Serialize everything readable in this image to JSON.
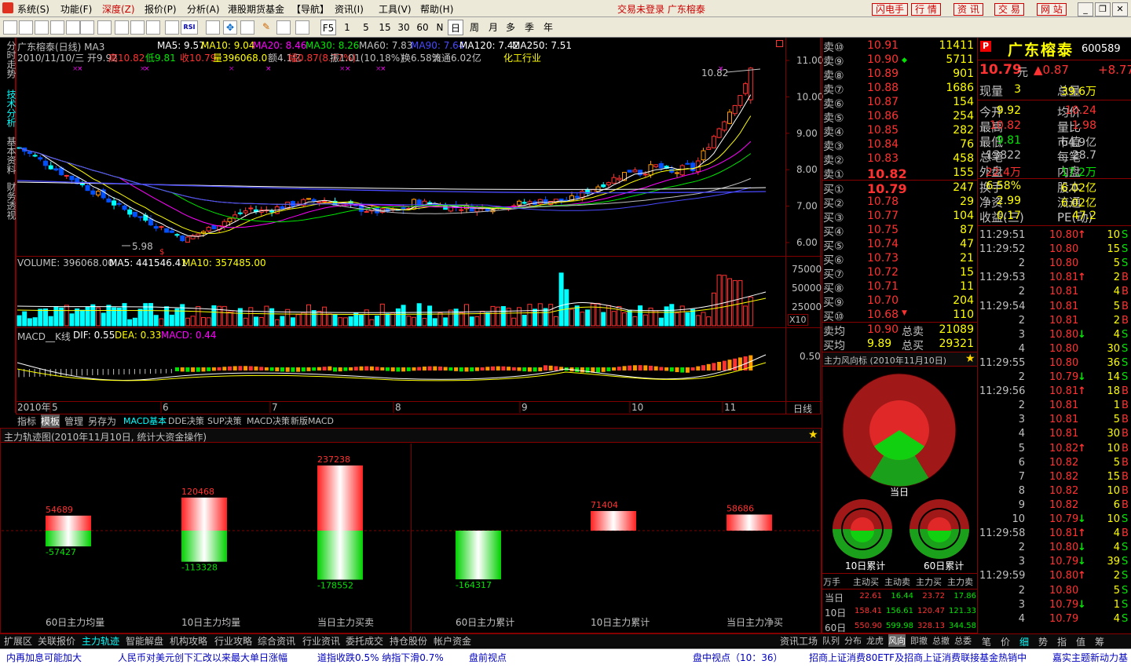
{
  "menu": {
    "items": [
      "系统(S)",
      "功能(F)",
      "深度(Z)",
      "报价(P)",
      "分析(A)",
      "港股期货基金",
      "【导航】",
      "资讯(I)",
      "工具(V)",
      "帮助(H)"
    ],
    "status": "交易未登录  广东榕泰",
    "right_buttons": [
      "闪电手",
      "行 情",
      "资 讯",
      "交 易",
      "网 站"
    ]
  },
  "toolbar": {
    "periods": [
      "F5",
      "1",
      "5",
      "15",
      "30",
      "60",
      "N",
      "日",
      "周",
      "月",
      "多",
      "季",
      "年"
    ]
  },
  "left_tabs": [
    "分时走势",
    "技术分析",
    "基本资料",
    "财务透视"
  ],
  "chart": {
    "title": "广东榕泰(日线) MA3",
    "ma_labels": [
      {
        "t": "MA5: 9.57",
        "c": "#ffffff"
      },
      {
        "t": "MA10: 9.04",
        "c": "#ffff00"
      },
      {
        "t": "MA20: 8.46",
        "c": "#ff00ff"
      },
      {
        "t": "MA30: 8.26",
        "c": "#00e600"
      },
      {
        "t": "MA60: 7.83",
        "c": "#c0c0c0"
      },
      {
        "t": "MA90: 7.64",
        "c": "#4a4aff"
      },
      {
        "t": "MA120: 7.42",
        "c": "#ffffff"
      },
      {
        "t": "MA250: 7.51",
        "c": "#ffffff"
      }
    ],
    "info_line": [
      {
        "t": "2010/11/10/三 开9.92",
        "c": "#c0c0c0"
      },
      {
        "t": "高10.82",
        "c": "#ff3232"
      },
      {
        "t": "低9.81",
        "c": "#00e600"
      },
      {
        "t": "收10.79",
        "c": "#ff3232"
      },
      {
        "t": "量396068.0",
        "c": "#ffff00"
      },
      {
        "t": "额4.1亿",
        "c": "#c0c0c0"
      },
      {
        "t": "幅0.87(8.77%)",
        "c": "#ff3232"
      },
      {
        "t": "振1.01(10.18%)",
        "c": "#c0c0c0"
      },
      {
        "t": "换6.58%",
        "c": "#c0c0c0"
      },
      {
        "t": "流通6.02亿",
        "c": "#c0c0c0"
      },
      {
        "t": "化工行业",
        "c": "#ffff00"
      }
    ],
    "price_axis": [
      "11.00",
      "10.00",
      "9.00",
      "8.00",
      "7.00",
      "6.00"
    ],
    "high_mark": "10.82",
    "low_mark": "5.98",
    "volume_title": "VOLUME: 396068.00",
    "volume_ma5": "MA5: 441546.41",
    "volume_ma10": "MA10: 357485.00",
    "volume_axis": [
      "75000",
      "50000",
      "25000"
    ],
    "volume_unit": "X10",
    "macd_title": "MACD__K线",
    "macd_dif": "DIF: 0.55",
    "macd_dea": "DEA: 0.33",
    "macd_val": "MACD: 0.44",
    "macd_axis": "0.50",
    "date_labels": [
      "2010年",
      "5",
      "6",
      "7",
      "8",
      "9",
      "10",
      "11"
    ],
    "period_label": "日线"
  },
  "indicator_tabs": [
    "指标",
    "模板",
    "管理",
    "另存为",
    "MACD基本",
    "DDE决策",
    "SUP决策",
    "MACD决策",
    "新版MACD"
  ],
  "main_force": {
    "title": "主力轨迹图(2010年11月10日, 统计大资金操作)",
    "groups": [
      {
        "label": "60日主力均量",
        "pos": "54689",
        "neg": "-57427"
      },
      {
        "label": "10日主力均量",
        "pos": "120468",
        "neg": "-113328"
      },
      {
        "label": "当日主力买卖",
        "pos": "237238",
        "neg": "-178552"
      },
      {
        "label": "60日主力累计",
        "pos": "",
        "neg": "-164317"
      },
      {
        "label": "10日主力累计",
        "pos": "71404",
        "neg": ""
      },
      {
        "label": "当日主力净买",
        "pos": "58686",
        "neg": ""
      }
    ]
  },
  "bottom_tabs": [
    "扩展区",
    "关联报价",
    "主力轨迹",
    "智能解盘",
    "机构攻略",
    "行业攻略",
    "综合资讯",
    "行业资讯",
    "委托成交",
    "持仓股份",
    "帐户资金"
  ],
  "bottom_right": "资讯工场",
  "ticker": [
    "内再加息可能加大",
    "人民币对美元创下汇改以来最大单日涨幅",
    "道指收跌0.5% 纳指下滑0.7%",
    "盘前视点",
    "盘中视点（10：36）",
    "招商上证消费80ETF及招商上证消费联接基金热销中",
    "嘉实主题新动力基"
  ],
  "order_book": {
    "asks": [
      {
        "l": "卖⑩",
        "p": "10.91",
        "v": "11411"
      },
      {
        "l": "卖⑨",
        "p": "10.90",
        "v": "5711"
      },
      {
        "l": "卖⑧",
        "p": "10.89",
        "v": "901"
      },
      {
        "l": "卖⑦",
        "p": "10.88",
        "v": "1686"
      },
      {
        "l": "卖⑥",
        "p": "10.87",
        "v": "154"
      },
      {
        "l": "卖⑤",
        "p": "10.86",
        "v": "254"
      },
      {
        "l": "卖④",
        "p": "10.85",
        "v": "282"
      },
      {
        "l": "卖③",
        "p": "10.84",
        "v": "76"
      },
      {
        "l": "卖②",
        "p": "10.83",
        "v": "458"
      },
      {
        "l": "卖①",
        "p": "10.82",
        "v": "155"
      }
    ],
    "bids": [
      {
        "l": "买①",
        "p": "10.79",
        "v": "247"
      },
      {
        "l": "买②",
        "p": "10.78",
        "v": "29"
      },
      {
        "l": "买③",
        "p": "10.77",
        "v": "104"
      },
      {
        "l": "买④",
        "p": "10.75",
        "v": "87"
      },
      {
        "l": "买⑤",
        "p": "10.74",
        "v": "47"
      },
      {
        "l": "买⑥",
        "p": "10.73",
        "v": "21"
      },
      {
        "l": "买⑦",
        "p": "10.72",
        "v": "15"
      },
      {
        "l": "买⑧",
        "p": "10.71",
        "v": "11"
      },
      {
        "l": "买⑨",
        "p": "10.70",
        "v": "204"
      },
      {
        "l": "买⑩",
        "p": "10.68",
        "v": "110"
      }
    ],
    "avg_sell": {
      "l": "卖均",
      "p": "10.90",
      "tl": "总卖",
      "tv": "21089"
    },
    "avg_buy": {
      "l": "买均",
      "p": "9.89",
      "tl": "总买",
      "tv": "29321"
    }
  },
  "flow": {
    "title": "主力风向标 (2010年11月10日)",
    "today": "当日",
    "d10": "10日累计",
    "d60": "60日累计",
    "headers": [
      "万手",
      "主动买",
      "主动卖",
      "主力买",
      "主力卖"
    ],
    "rows": [
      {
        "l": "当日",
        "v": [
          "22.61",
          "16.44",
          "23.72",
          "17.86"
        ]
      },
      {
        "l": "10日",
        "v": [
          "158.41",
          "156.61",
          "120.47",
          "121.33"
        ]
      },
      {
        "l": "60日",
        "v": [
          "550.90",
          "599.98",
          "328.13",
          "344.58"
        ]
      }
    ],
    "tabs": [
      "队列",
      "分布",
      "龙虎",
      "风向",
      "即撤",
      "总撤",
      "总委"
    ]
  },
  "quote": {
    "name": "广东榕泰",
    "code": "600589",
    "price": "10.79",
    "unit": "元",
    "change": "▲0.87",
    "change2": "+8.77",
    "rows": [
      [
        {
          "l": "现量",
          "v": "3"
        },
        {
          "l": "总量",
          "v": "39.6万"
        }
      ],
      [
        {
          "l": "今开",
          "v": "9.92"
        },
        {
          "l": "均价",
          "v": "10.24"
        }
      ],
      [
        {
          "l": "最高",
          "v": "10.82"
        },
        {
          "l": "量比",
          "v": "1.98"
        }
      ],
      [
        {
          "l": "最低",
          "v": "9.81"
        },
        {
          "l": "市值",
          "v": "64.9亿"
        }
      ],
      [
        {
          "l": "总笔",
          "v": "13822"
        },
        {
          "l": "每笔",
          "v": "28.7"
        }
      ],
      [
        {
          "l": "外盘",
          "v": "22.4万"
        },
        {
          "l": "内盘",
          "v": "17.2万"
        }
      ],
      [
        {
          "l": "换手",
          "v": "6.58%"
        },
        {
          "l": "股本",
          "v": "6.02亿"
        }
      ],
      [
        {
          "l": "净资",
          "v": "2.99"
        },
        {
          "l": "流通",
          "v": "6.02亿"
        }
      ],
      [
        {
          "l": "收益(三)",
          "v": "0.17"
        },
        {
          "l": "PE(动)",
          "v": "47.2"
        }
      ]
    ],
    "row_colors": [
      [
        "#ffff00",
        "#ffff00"
      ],
      [
        "#ffff00",
        "#ff3232"
      ],
      [
        "#ff3232",
        "#ff3232"
      ],
      [
        "#00e600",
        "#c0c0c0"
      ],
      [
        "#c0c0c0",
        "#c0c0c0"
      ],
      [
        "#ff3232",
        "#00e600"
      ],
      [
        "#ffff00",
        "#ffff00"
      ],
      [
        "#ffff00",
        "#ffff00"
      ],
      [
        "#ffff00",
        "#ffff00"
      ]
    ]
  },
  "ticks": [
    {
      "t": "11:29:51",
      "p": "10.80",
      "a": "↑",
      "v": "10",
      "s": "S"
    },
    {
      "t": "11:29:52",
      "p": "10.80",
      "a": "",
      "v": "15",
      "s": "S"
    },
    {
      "t": "2",
      "p": "10.80",
      "a": "",
      "v": "5",
      "s": "S"
    },
    {
      "t": "11:29:53",
      "p": "10.81",
      "a": "↑",
      "v": "2",
      "s": "B"
    },
    {
      "t": "2",
      "p": "10.81",
      "a": "",
      "v": "4",
      "s": "B"
    },
    {
      "t": "11:29:54",
      "p": "10.81",
      "a": "",
      "v": "5",
      "s": "B"
    },
    {
      "t": "2",
      "p": "10.81",
      "a": "",
      "v": "2",
      "s": "B"
    },
    {
      "t": "3",
      "p": "10.80",
      "a": "↓",
      "v": "4",
      "s": "S"
    },
    {
      "t": "4",
      "p": "10.80",
      "a": "",
      "v": "30",
      "s": "S"
    },
    {
      "t": "11:29:55",
      "p": "10.80",
      "a": "",
      "v": "36",
      "s": "S"
    },
    {
      "t": "2",
      "p": "10.79",
      "a": "↓",
      "v": "14",
      "s": "S"
    },
    {
      "t": "11:29:56",
      "p": "10.81",
      "a": "↑",
      "v": "18",
      "s": "B"
    },
    {
      "t": "2",
      "p": "10.81",
      "a": "",
      "v": "1",
      "s": "B"
    },
    {
      "t": "3",
      "p": "10.81",
      "a": "",
      "v": "5",
      "s": "B"
    },
    {
      "t": "4",
      "p": "10.81",
      "a": "",
      "v": "30",
      "s": "B"
    },
    {
      "t": "5",
      "p": "10.82",
      "a": "↑",
      "v": "10",
      "s": "B"
    },
    {
      "t": "6",
      "p": "10.82",
      "a": "",
      "v": "5",
      "s": "B"
    },
    {
      "t": "7",
      "p": "10.82",
      "a": "",
      "v": "15",
      "s": "B"
    },
    {
      "t": "8",
      "p": "10.82",
      "a": "",
      "v": "10",
      "s": "B"
    },
    {
      "t": "9",
      "p": "10.82",
      "a": "",
      "v": "6",
      "s": "B"
    },
    {
      "t": "10",
      "p": "10.79",
      "a": "↓",
      "v": "10",
      "s": "S"
    },
    {
      "t": "11:29:58",
      "p": "10.81",
      "a": "↑",
      "v": "4",
      "s": "B"
    },
    {
      "t": "2",
      "p": "10.80",
      "a": "↓",
      "v": "4",
      "s": "S"
    },
    {
      "t": "3",
      "p": "10.79",
      "a": "↓",
      "v": "39",
      "s": "S"
    },
    {
      "t": "11:29:59",
      "p": "10.80",
      "a": "↑",
      "v": "2",
      "s": "S"
    },
    {
      "t": "2",
      "p": "10.80",
      "a": "",
      "v": "5",
      "s": "S"
    },
    {
      "t": "3",
      "p": "10.79",
      "a": "↓",
      "v": "1",
      "s": "S"
    },
    {
      "t": "4",
      "p": "10.79",
      "a": "",
      "v": "4",
      "s": "S"
    }
  ],
  "right_tabs": [
    "笔",
    "价",
    "细",
    "势",
    "指",
    "值",
    "筹"
  ]
}
